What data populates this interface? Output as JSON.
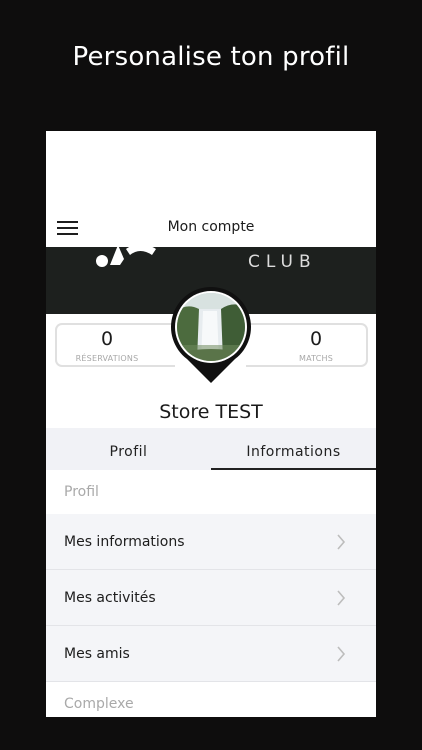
{
  "headline": "Personalise ton profil",
  "app": {
    "topbar": {
      "title": "Mon compte",
      "menu_icon": "hamburger-menu-icon"
    },
    "banner": {
      "club_text": "CLUB"
    },
    "stats": {
      "reservations": {
        "value": "0",
        "label": "RÉSERVATIONS"
      },
      "matchs": {
        "value": "0",
        "label": "MATCHS"
      }
    },
    "profile": {
      "name": "Store TEST",
      "avatar": "waterfall-landscape-photo"
    },
    "tabs": [
      {
        "label": "Profil",
        "active": false
      },
      {
        "label": "Informations",
        "active": true
      }
    ],
    "sections": {
      "profil": {
        "header": "Profil",
        "rows": [
          {
            "label": "Mes informations"
          },
          {
            "label": "Mes activités"
          },
          {
            "label": "Mes amis"
          }
        ]
      },
      "complexe": {
        "header": "Complexe"
      }
    }
  },
  "colors": {
    "background": "#0e0d0d",
    "banner": "#1d201e",
    "row_background": "#f4f5f8",
    "tab_background": "#f1f2f6"
  }
}
